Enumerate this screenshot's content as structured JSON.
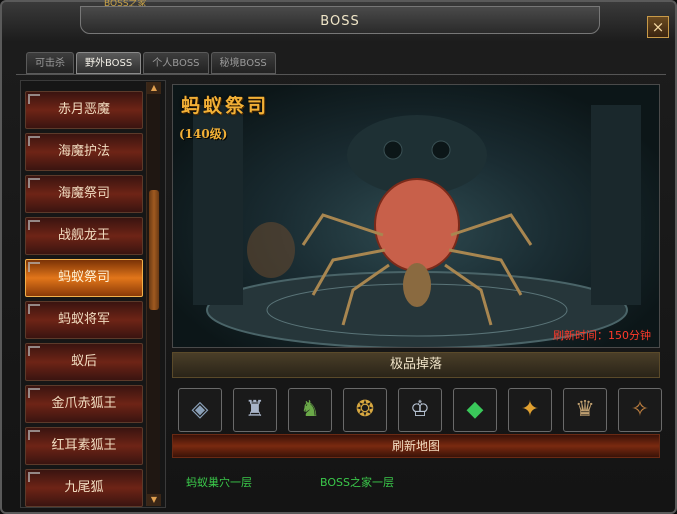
{
  "window": {
    "title": "BOSS",
    "top_tag": "BOSS之家",
    "close_label": "×"
  },
  "tabs": [
    {
      "label": "可击杀",
      "active": false
    },
    {
      "label": "野外BOSS",
      "active": true
    },
    {
      "label": "个人BOSS",
      "active": false
    },
    {
      "label": "秘境BOSS",
      "active": false
    }
  ],
  "boss_list": {
    "items": [
      {
        "label": "赤月恶魔"
      },
      {
        "label": "海魔护法"
      },
      {
        "label": "海魔祭司"
      },
      {
        "label": "战舰龙王"
      },
      {
        "label": "蚂蚁祭司",
        "selected": true
      },
      {
        "label": "蚂蚁将军"
      },
      {
        "label": "蚁后"
      },
      {
        "label": "金爪赤狐王"
      },
      {
        "label": "红耳素狐王"
      },
      {
        "label": "九尾狐"
      }
    ],
    "scroll_up": "▲",
    "scroll_down": "▼"
  },
  "boss": {
    "name": "蚂蚁祭司",
    "level": "(140级)",
    "refresh_time": "刷新时间：150分钟"
  },
  "drops": {
    "header": "极品掉落",
    "items": [
      {
        "icon": "shoulder-armor-icon",
        "color": "#8aa0b8"
      },
      {
        "icon": "horned-helmet-icon",
        "color": "#a8b4c8"
      },
      {
        "icon": "green-armor-icon",
        "color": "#6aa848"
      },
      {
        "icon": "gold-necklace-icon",
        "color": "#d8a840"
      },
      {
        "icon": "silver-crown-icon",
        "color": "#b8c4d4"
      },
      {
        "icon": "jade-medal-icon",
        "color": "#3ac85a"
      },
      {
        "icon": "gold-emblem-icon",
        "color": "#e0a030"
      },
      {
        "icon": "winged-armor-icon",
        "color": "#c0a070"
      },
      {
        "icon": "bronze-wings-icon",
        "color": "#c08040"
      }
    ]
  },
  "map": {
    "header": "刷新地图",
    "links": [
      "蚂蚁巢穴一层",
      "BOSS之家一层"
    ]
  }
}
